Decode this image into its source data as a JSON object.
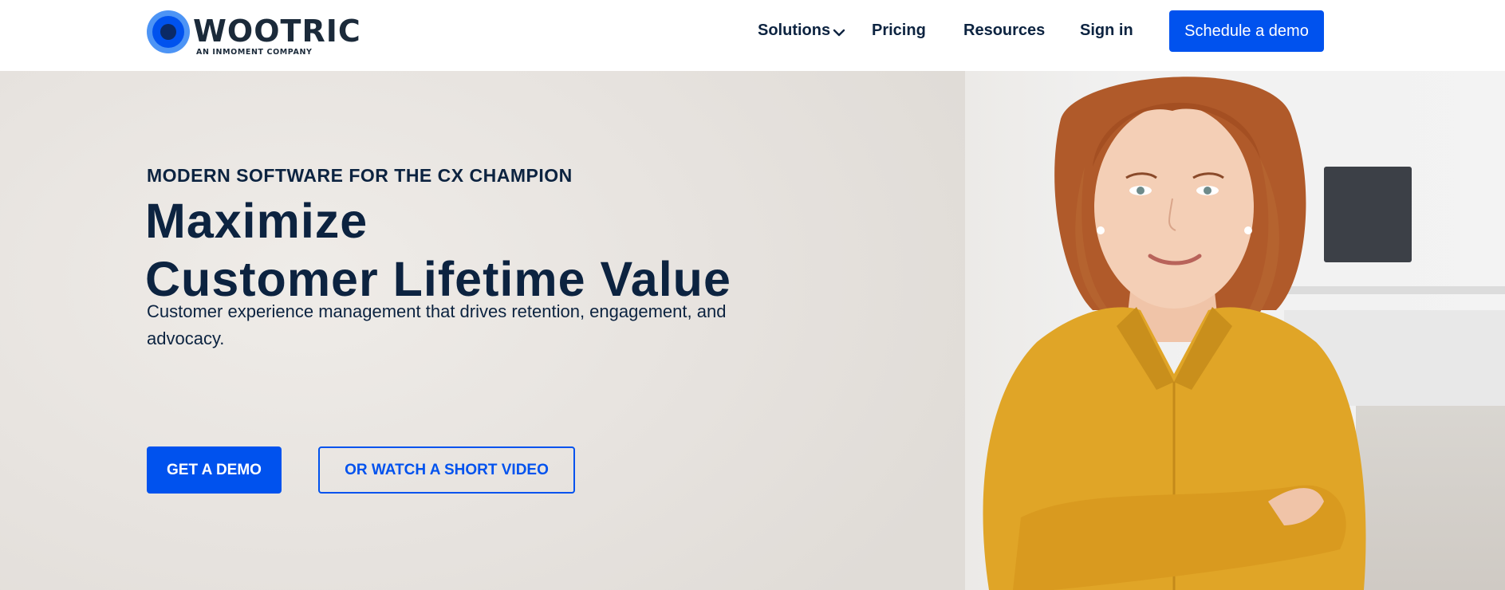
{
  "brand": {
    "name": "WOOTRIC",
    "tagline": "AN INMOMENT COMPANY",
    "colors": {
      "primary": "#0052ee",
      "text": "#0c2340",
      "logo_light": "#4d94f5",
      "logo_dark": "#0b2a66"
    }
  },
  "nav": {
    "items": [
      {
        "label": "Solutions",
        "icon": "chevron-down-icon"
      },
      {
        "label": "Pricing"
      },
      {
        "label": "Resources"
      },
      {
        "label": "Sign in"
      }
    ],
    "cta_label": "Schedule a demo"
  },
  "hero": {
    "eyebrow": "MODERN SOFTWARE FOR THE CX CHAMPION",
    "headline_line1": "Maximize",
    "headline_line2": "Customer Lifetime Value",
    "subtext": "Customer experience management that drives retention, engagement, and advocacy.",
    "primary_button": "GET A DEMO",
    "secondary_button": "OR WATCH A SHORT VIDEO"
  }
}
